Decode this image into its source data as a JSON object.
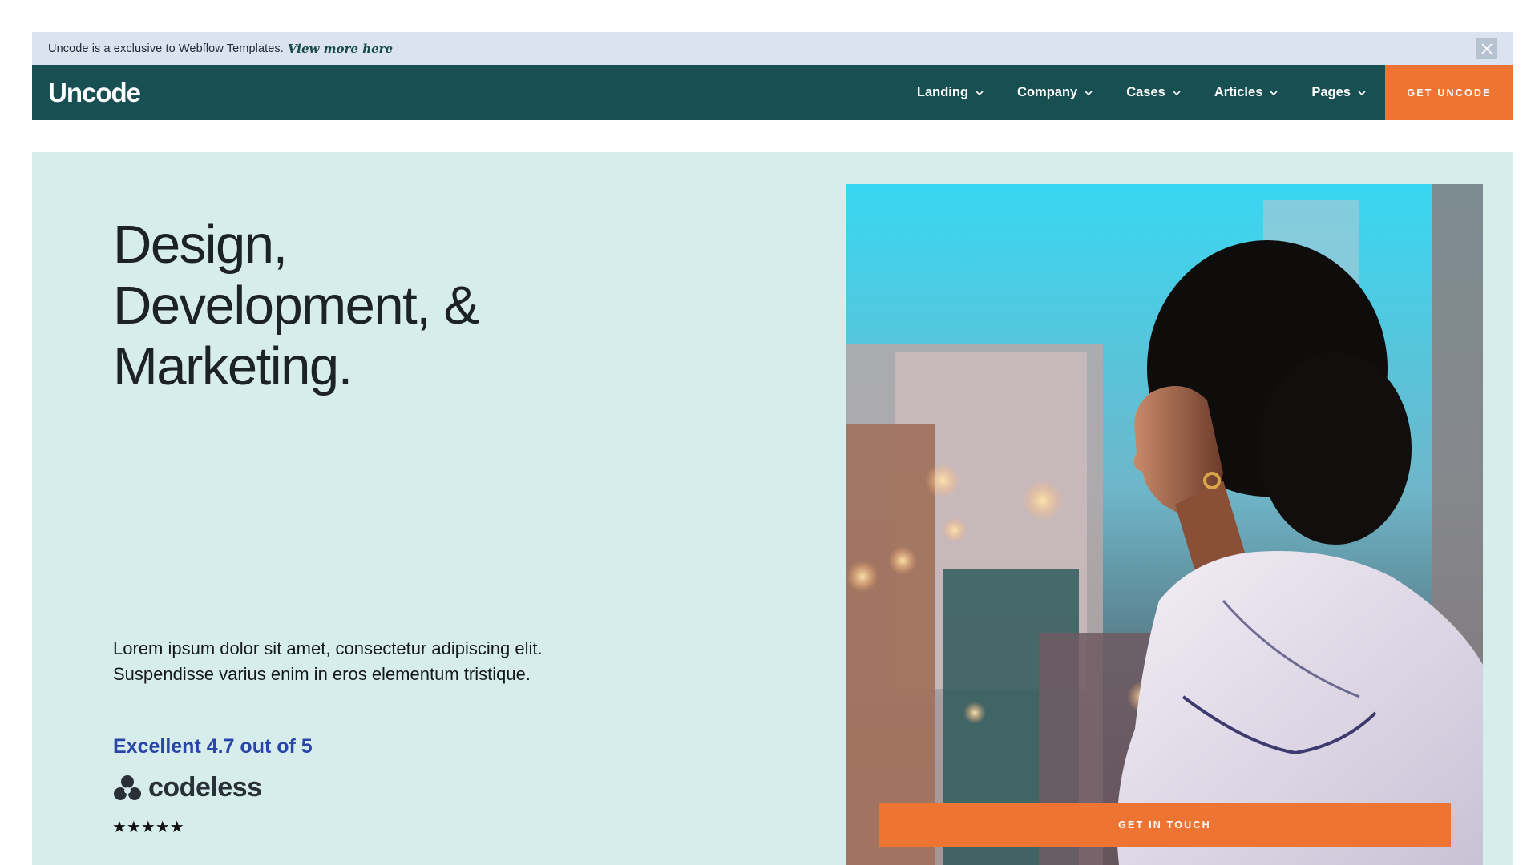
{
  "announcement": {
    "message": "Uncode is a exclusive to Webflow Templates.",
    "link_label": "View more here",
    "close_icon": "close-icon"
  },
  "nav": {
    "logo": "Uncode",
    "items": [
      {
        "label": "Landing",
        "icon": "chevron-down-icon"
      },
      {
        "label": "Company",
        "icon": "chevron-down-icon"
      },
      {
        "label": "Cases",
        "icon": "chevron-down-icon"
      },
      {
        "label": "Articles",
        "icon": "chevron-down-icon"
      },
      {
        "label": "Pages",
        "icon": "chevron-down-icon"
      }
    ],
    "cta_label": "GET UNCODE"
  },
  "hero": {
    "headline_lines": [
      "Design,",
      "Development, &",
      "Marketing."
    ],
    "lede_lines": [
      "Lorem ipsum dolor sit amet, consectetur adipiscing elit.",
      "Suspendisse varius enim in eros elementum tristique."
    ],
    "rating_text": "Excellent 4.7 out of 5",
    "brand_name": "codeless",
    "brand_icon": "codeless-logo-icon",
    "stars": "★★★★★",
    "stars_count": 5,
    "cta_label": "GET IN TOUCH"
  },
  "colors": {
    "announce_bg": "#dbe3f1",
    "nav_bg": "#174f52",
    "accent_orange": "#ee7434",
    "hero_bg": "#d6edec",
    "rating_blue": "#2a45a8"
  }
}
